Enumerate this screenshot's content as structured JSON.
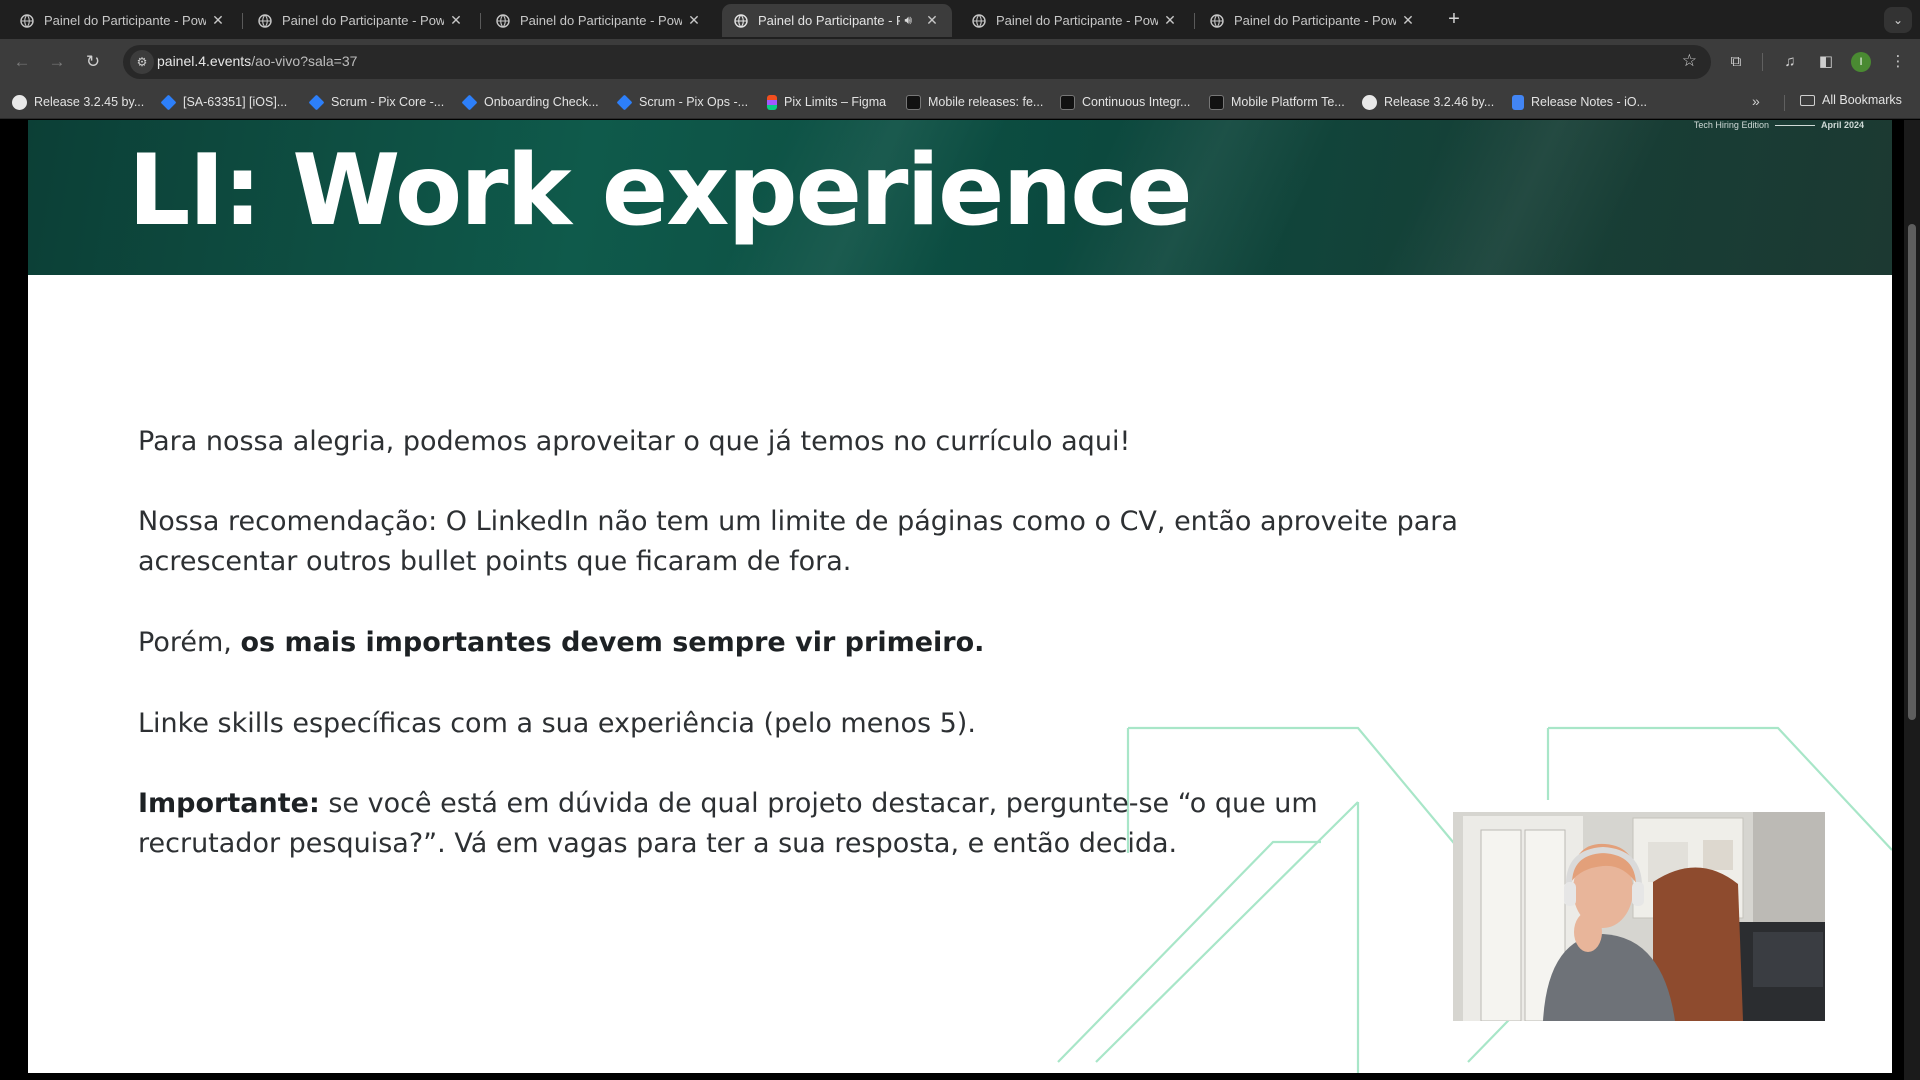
{
  "browser": {
    "tabs": [
      {
        "title": "Painel do Participante - Power",
        "active": false
      },
      {
        "title": "Painel do Participante - Power",
        "active": false
      },
      {
        "title": "Painel do Participante - Power",
        "active": false
      },
      {
        "title": "Painel do Participante - Po",
        "active": true,
        "audio": true
      },
      {
        "title": "Painel do Participante - Power",
        "active": false
      },
      {
        "title": "Painel do Participante - Power",
        "active": false
      }
    ],
    "new_tab_label": "+",
    "url_host": "painel.4.events",
    "url_path": "/ao-vivo?sala=37",
    "profile_initial": "I"
  },
  "bookmarks": {
    "items": [
      {
        "label": "Release 3.2.45 by...",
        "icon": "github-icon"
      },
      {
        "label": "[SA-63351] [iOS]...",
        "icon": "jira-icon"
      },
      {
        "label": "Scrum - Pix Core -...",
        "icon": "jira-icon"
      },
      {
        "label": "Onboarding Check...",
        "icon": "confluence-icon"
      },
      {
        "label": "Scrum - Pix Ops -...",
        "icon": "jira-icon"
      },
      {
        "label": "Pix Limits – Figma",
        "icon": "figma-icon"
      },
      {
        "label": "Mobile releases: fe...",
        "icon": "app-icon"
      },
      {
        "label": "Continuous Integr...",
        "icon": "app-icon"
      },
      {
        "label": "Mobile Platform Te...",
        "icon": "app-icon"
      },
      {
        "label": "Release 3.2.46 by...",
        "icon": "github-icon"
      },
      {
        "label": "Release Notes - iO...",
        "icon": "docs-icon"
      }
    ],
    "all_bookmarks_label": "All Bookmarks"
  },
  "slide": {
    "title": "LI: Work experience",
    "edition_left": "Tech Hiring Edition",
    "edition_right": "April 2024",
    "para1": "Para nossa alegria, podemos aproveitar o que já temos no currículo aqui!",
    "para2": "Nossa recomendação: O LinkedIn não tem um limite de páginas como o CV, então aproveite para acrescentar outros bullet points que ficaram de fora.",
    "para3_prefix": "Porém, ",
    "para3_bold": "os mais importantes devem sempre vir primeiro.",
    "para4": "Linke skills específicas com a sua experiência (pelo menos 5).",
    "para5_bold": "Importante:",
    "para5_rest": " se você está em dúvida de qual projeto destacar, pergunte-se “o que um recrutador pesquisa?”. Vá em vagas para ter a sua resposta, e então decida."
  },
  "colors": {
    "banner": "#0f5a4b",
    "deco_line": "#a8e6c8",
    "text": "#2d3033",
    "chrome_bg": "#3c3c3c"
  }
}
